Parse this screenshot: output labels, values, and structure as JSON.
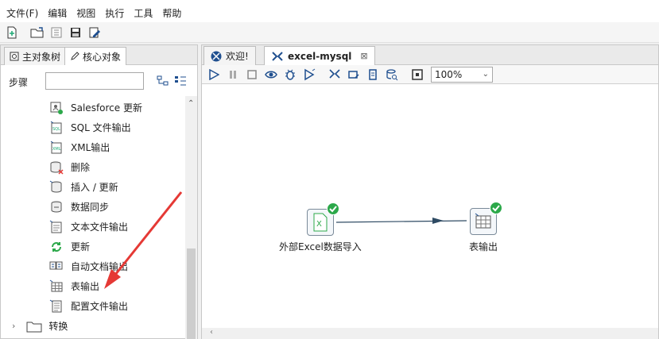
{
  "menu": [
    "文件(F)",
    "编辑",
    "视图",
    "执行",
    "工具",
    "帮助"
  ],
  "left_tabs": {
    "main_tree": "主对象树",
    "core_objects": "核心对象"
  },
  "steps": {
    "label": "步骤",
    "placeholder": ""
  },
  "tree_items": [
    {
      "label": "Salesforce 更新",
      "icon": "salesforce-update-icon"
    },
    {
      "label": "SQL 文件输出",
      "icon": "sql-file-icon"
    },
    {
      "label": "XML输出",
      "icon": "xml-file-icon"
    },
    {
      "label": "删除",
      "icon": "delete-icon"
    },
    {
      "label": "插入 / 更新",
      "icon": "insert-update-icon"
    },
    {
      "label": "数据同步",
      "icon": "data-sync-icon"
    },
    {
      "label": "文本文件输出",
      "icon": "text-file-icon"
    },
    {
      "label": "更新",
      "icon": "refresh-icon"
    },
    {
      "label": "自动文档输出",
      "icon": "auto-doc-icon"
    },
    {
      "label": "表输出",
      "icon": "table-icon"
    },
    {
      "label": "配置文件输出",
      "icon": "config-file-icon"
    }
  ],
  "tree_folder": {
    "label": "转换",
    "icon": "folder-icon"
  },
  "right_tabs": {
    "welcome": "欢迎!",
    "transform": "excel-mysql"
  },
  "zoom": "100%",
  "nodes": {
    "input": "外部Excel数据导入",
    "output": "表输出"
  },
  "colors": {
    "accent_red": "#e53935",
    "success_green": "#2ca84a",
    "toolbar_blue": "#1f4f8f"
  }
}
